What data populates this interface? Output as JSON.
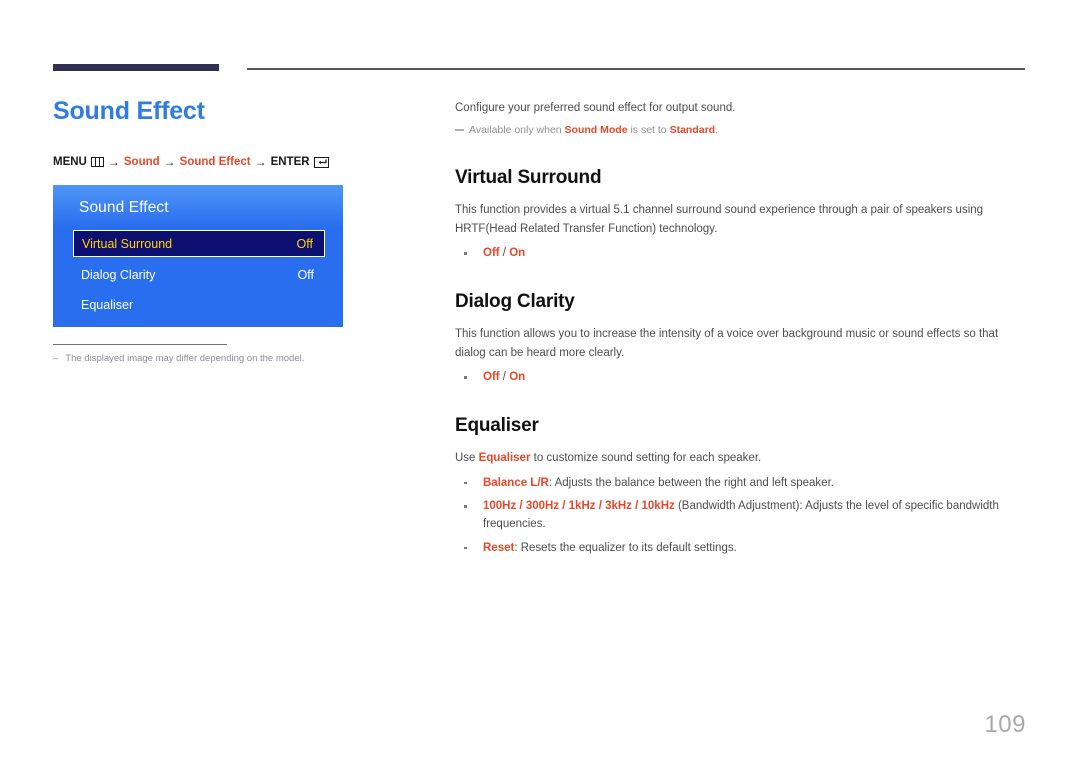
{
  "document": {
    "page_number": "109"
  },
  "left": {
    "page_title": "Sound Effect",
    "breadcrumb": {
      "menu_label": "MENU",
      "menu_icon": "menu-grid-icon",
      "arrow1": "→",
      "item1": "Sound",
      "arrow2": "→",
      "item2": "Sound Effect",
      "arrow3": "→",
      "enter_label": "ENTER",
      "enter_icon": "enter-return-icon"
    },
    "osd": {
      "title": "Sound Effect",
      "rows": [
        {
          "label": "Virtual Surround",
          "value": "Off",
          "selected": true
        },
        {
          "label": "Dialog Clarity",
          "value": "Off",
          "selected": false
        },
        {
          "label": "Equaliser",
          "value": "",
          "selected": false
        }
      ]
    },
    "footnote": {
      "dash": "–",
      "text": "The displayed image may differ depending on the model."
    }
  },
  "right": {
    "intro": "Configure your preferred sound effect for output sound.",
    "note": {
      "prefix": "Available only when ",
      "term1": "Sound Mode",
      "middle": " is set to ",
      "term2": "Standard",
      "suffix": "."
    },
    "sections": [
      {
        "heading": "Virtual Surround",
        "body": "This function provides a virtual 5.1 channel surround sound experience through a pair of speakers using HRTF(Head Related Transfer Function) technology.",
        "bullets": [
          {
            "bold": "Off",
            "separator": " / ",
            "bold2": "On",
            "rest": ""
          }
        ]
      },
      {
        "heading": "Dialog Clarity",
        "body": "This function allows you to increase the intensity of a voice over background music or sound effects so that dialog can be heard more clearly.",
        "bullets": [
          {
            "bold": "Off",
            "separator": " / ",
            "bold2": "On",
            "rest": ""
          }
        ]
      }
    ],
    "equaliser": {
      "heading": "Equaliser",
      "intro_pre": "Use ",
      "intro_bold": "Equaliser",
      "intro_post": " to customize sound setting for each speaker.",
      "bullets": [
        {
          "bold": "Balance L/R",
          "rest": ": Adjusts the balance between the right and left speaker."
        },
        {
          "bold": "100Hz / 300Hz / 1kHz / 3kHz / 10kHz",
          "rest": " (Bandwidth Adjustment): Adjusts the level of specific bandwidth frequencies."
        },
        {
          "bold": "Reset",
          "rest": ": Resets the equalizer to its default settings."
        }
      ]
    }
  },
  "colors": {
    "title_blue": "#2f7de1",
    "accent_red": "#e8472a",
    "rule_navy": "#313052",
    "osd_blue": "#2a6ef0",
    "osd_selected_bg": "#0d1071",
    "osd_selected_text": "#ffd400"
  }
}
